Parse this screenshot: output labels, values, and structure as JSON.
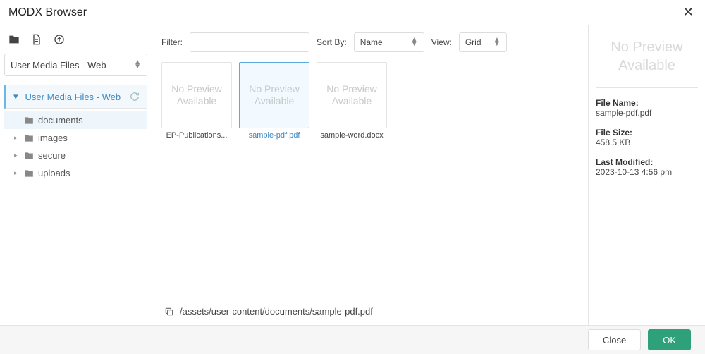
{
  "title": "MODX Browser",
  "sidebar": {
    "media_source": "User Media Files - Web",
    "root_label": "User Media Files - Web",
    "items": [
      {
        "label": "documents",
        "selected": true,
        "expandable": false
      },
      {
        "label": "images",
        "selected": false,
        "expandable": true
      },
      {
        "label": "secure",
        "selected": false,
        "expandable": true
      },
      {
        "label": "uploads",
        "selected": false,
        "expandable": true
      }
    ]
  },
  "controls": {
    "filter_label": "Filter:",
    "filter_value": "",
    "sortby_label": "Sort By:",
    "sortby_value": "Name",
    "view_label": "View:",
    "view_value": "Grid"
  },
  "grid": {
    "placeholder_text": "No Preview Available",
    "items": [
      {
        "filename": "EP-Publications...",
        "selected": false
      },
      {
        "filename": "sample-pdf.pdf",
        "selected": true
      },
      {
        "filename": "sample-word.docx",
        "selected": false
      }
    ]
  },
  "pathbar": "/assets/user-content/documents/sample-pdf.pdf",
  "preview": {
    "placeholder": "No Preview Available",
    "filename_label": "File Name:",
    "filename_value": "sample-pdf.pdf",
    "filesize_label": "File Size:",
    "filesize_value": "458.5 KB",
    "modified_label": "Last Modified:",
    "modified_value": "2023-10-13 4:56 pm"
  },
  "footer": {
    "close_label": "Close",
    "ok_label": "OK"
  }
}
